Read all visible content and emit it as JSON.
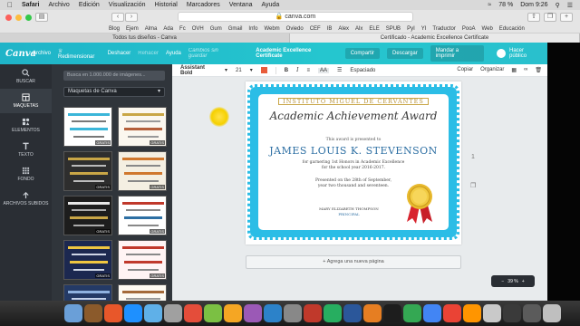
{
  "menubar": {
    "app": "Safari",
    "items": [
      "Archivo",
      "Edición",
      "Visualización",
      "Historial",
      "Marcadores",
      "Ventana",
      "Ayuda"
    ],
    "battery": "78 %",
    "clock": "Dom 9:26"
  },
  "browser": {
    "url": "canva.com",
    "bookmarks": [
      "Blog",
      "Ejem",
      "Alma",
      "Ada",
      "Fc",
      "OVH",
      "Gum",
      "Gmail",
      "Info",
      "Webm",
      "Oviedo",
      "CEF",
      "IB",
      "Alex",
      "Alx",
      "ELE",
      "SPUB",
      "PyI",
      "YI",
      "Traductor",
      "PooA",
      "Web",
      "Educación"
    ],
    "tabs": [
      {
        "label": "Todos tus diseños - Canva",
        "active": false
      },
      {
        "label": "Certificado - Academic Excellence Certificate",
        "active": true
      }
    ]
  },
  "canva": {
    "logo": "Canva",
    "file": "Archivo",
    "resize": "Redimensionar",
    "undo": "Deshacer",
    "redo": "Rehacer",
    "help": "Ayuda",
    "saved": "Cambios sin guardar",
    "title": "Academic Excellence Certificate",
    "share": "Compartir",
    "download": "Descargar",
    "print": "Mandar a imprimir",
    "publish": "Hacer público"
  },
  "sidebar": {
    "items": [
      {
        "label": "BUSCAR",
        "icon": "search-icon",
        "active": false
      },
      {
        "label": "MAQUETAS",
        "icon": "layout-icon",
        "active": true
      },
      {
        "label": "ELEMENTOS",
        "icon": "shapes-icon",
        "active": false
      },
      {
        "label": "TEXTO",
        "icon": "text-icon",
        "active": false
      },
      {
        "label": "FONDO",
        "icon": "background-icon",
        "active": false
      },
      {
        "label": "ARCHIVOS SUBIDOS",
        "icon": "upload-icon",
        "active": false
      }
    ]
  },
  "panel": {
    "search_placeholder": "Busca en 1.000.000 de imágenes...",
    "select_value": "Maquetas de Canva",
    "thumb_badge": "GRATIS"
  },
  "editbar": {
    "font": "Assistant Bold",
    "size": "21",
    "bold": "B",
    "italic": "I",
    "case": "AA",
    "spacing": "Espaciado",
    "copy": "Copiar",
    "arrange": "Organizar"
  },
  "certificate": {
    "institution": "INSTITUTO MIGUEL DE CERVANTES",
    "award": "Academic Achievement Award",
    "presented": "This award is presented to",
    "name": "JAMES LOUIS K. STEVENSON",
    "line1": "for garnering 1st Honors in Academic Excellence",
    "line2": "for the school year 2016-2017.",
    "line3": "Presented on the 28th of September,",
    "line4": "year two thousand and seventeen.",
    "signer": "MARY ELIZABETH THOMPSON",
    "role": "PRINCIPAL",
    "colors": {
      "border": "#2bbde6",
      "name": "#2d6fa3",
      "gold": "#c9a646",
      "ribbon": "#d8242e"
    }
  },
  "canvas": {
    "page_number": "1",
    "add_page": "+ Agrega una nueva página",
    "zoom": "39 %"
  }
}
